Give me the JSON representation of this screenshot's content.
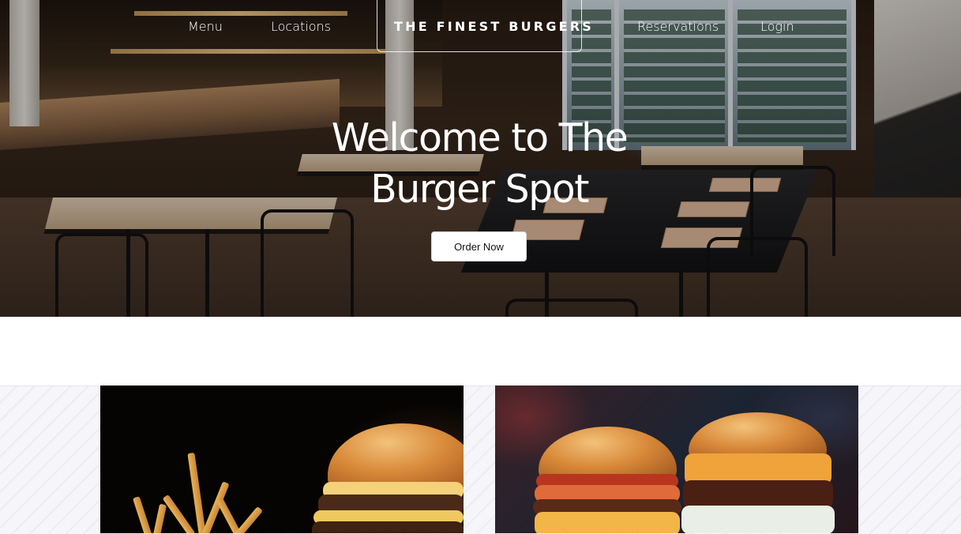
{
  "nav": {
    "links": [
      "Menu",
      "Locations",
      "Reservations",
      "Login"
    ],
    "brand": "THE FINEST BURGERS"
  },
  "hero": {
    "title_line1": "Welcome to The",
    "title_line2": "Burger Spot",
    "cta_label": "Order Now"
  },
  "colors": {
    "hero_text": "#ffffff",
    "button_bg": "#ffffff",
    "button_text": "#111111",
    "page_bg": "#ffffff"
  },
  "gallery": {
    "images": [
      "burger-with-fries-photo",
      "double-burgers-photo"
    ]
  }
}
